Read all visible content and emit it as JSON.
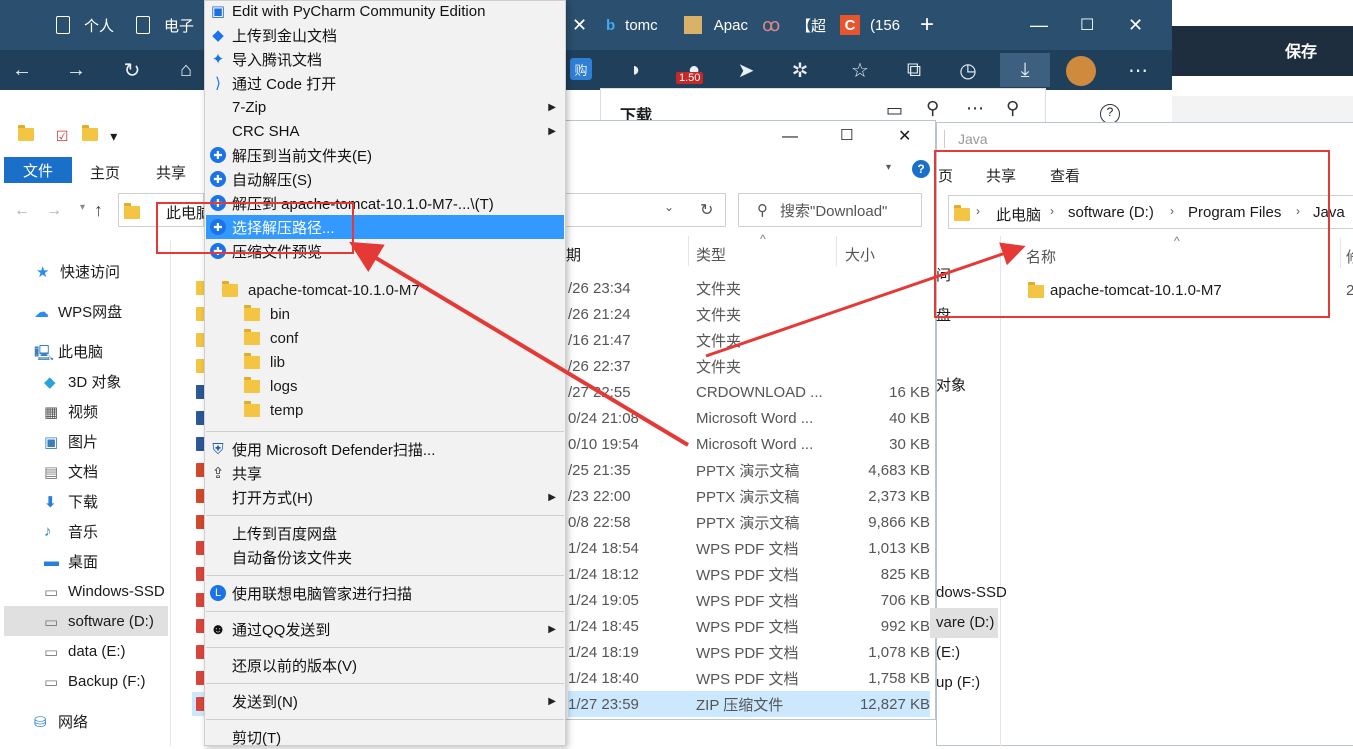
{
  "browser": {
    "tabs": [
      "个人",
      "电子",
      "tomc",
      "Apac",
      "【超",
      "(156"
    ],
    "tab_badge": "1.50",
    "save_label": "保存"
  },
  "downloads_panel": {
    "title": "下载"
  },
  "explorer_left": {
    "ribbon": [
      "文件",
      "主页",
      "共享"
    ],
    "breadcrumb": "此电脑",
    "search_placeholder": "搜索\"Download\"",
    "sidebar": [
      "快速访问",
      "WPS网盘",
      "此电脑",
      "3D 对象",
      "视频",
      "图片",
      "文档",
      "下载",
      "音乐",
      "桌面",
      "Windows-SSD",
      "software (D:)",
      "data (E:)",
      "Backup (F:)",
      "网络"
    ],
    "columns": {
      "date": "期",
      "type": "类型",
      "size": "大小"
    },
    "rows": [
      {
        "date": "/26 23:34",
        "type": "文件夹",
        "size": ""
      },
      {
        "date": "/26 21:24",
        "type": "文件夹",
        "size": ""
      },
      {
        "date": "/16 21:47",
        "type": "文件夹",
        "size": ""
      },
      {
        "date": "/26 22:37",
        "type": "文件夹",
        "size": ""
      },
      {
        "date": "/27 22:55",
        "type": "CRDOWNLOAD ...",
        "size": "16 KB"
      },
      {
        "date": "0/24 21:08",
        "type": "Microsoft Word ...",
        "size": "40 KB"
      },
      {
        "date": "0/10 19:54",
        "type": "Microsoft Word ...",
        "size": "30 KB"
      },
      {
        "date": "/25 21:35",
        "type": "PPTX 演示文稿",
        "size": "4,683 KB"
      },
      {
        "date": "/23 22:00",
        "type": "PPTX 演示文稿",
        "size": "2,373 KB"
      },
      {
        "date": "0/8 22:58",
        "type": "PPTX 演示文稿",
        "size": "9,866 KB"
      },
      {
        "date": "1/24 18:54",
        "type": "WPS PDF 文档",
        "size": "1,013 KB"
      },
      {
        "date": "1/24 18:12",
        "type": "WPS PDF 文档",
        "size": "825 KB"
      },
      {
        "date": "1/24 19:05",
        "type": "WPS PDF 文档",
        "size": "706 KB"
      },
      {
        "date": "1/24 18:45",
        "type": "WPS PDF 文档",
        "size": "992 KB"
      },
      {
        "date": "1/24 18:19",
        "type": "WPS PDF 文档",
        "size": "1,078 KB"
      },
      {
        "date": "1/24 18:40",
        "type": "WPS PDF 文档",
        "size": "1,758 KB"
      },
      {
        "date": "1/27 23:59",
        "type": "ZIP 压缩文件",
        "size": "12,827 KB"
      }
    ]
  },
  "explorer_right": {
    "title": "Java",
    "ribbon": [
      "页",
      "共享",
      "查看"
    ],
    "breadcrumb": [
      "此电脑",
      "software (D:)",
      "Program Files",
      "Java"
    ],
    "column_name": "名称",
    "item": "apache-tomcat-10.1.0-M7",
    "partial_side": [
      "问",
      "盘",
      "对象",
      "dows-SSD",
      "vare (D:)",
      "(E:)",
      "up (F:)"
    ],
    "partial_col": [
      "修",
      "2"
    ]
  },
  "context_menu": {
    "items": [
      {
        "label": "Edit with PyCharm Community Edition",
        "icon": "pycharm-icon"
      },
      {
        "label": "上传到金山文档",
        "icon": "kdocs-icon"
      },
      {
        "label": "导入腾讯文档",
        "icon": "tencent-docs-icon"
      },
      {
        "label": "通过 Code 打开",
        "icon": "vscode-icon"
      },
      {
        "label": "7-Zip",
        "icon": "",
        "submenu": true
      },
      {
        "label": "CRC SHA",
        "icon": "",
        "submenu": true
      },
      {
        "label": "解压到当前文件夹(E)",
        "icon": "extract-icon"
      },
      {
        "label": "自动解压(S)",
        "icon": "extract-icon"
      },
      {
        "label": "解压到 apache-tomcat-10.1.0-M7-...\\(T)",
        "icon": "extract-icon"
      },
      {
        "label": "选择解压路径...",
        "icon": "extract-icon",
        "highlight": true
      },
      {
        "label": "压缩文件预览",
        "icon": "extract-icon"
      }
    ],
    "preview_tree": [
      "apache-tomcat-10.1.0-M7",
      "bin",
      "conf",
      "lib",
      "logs",
      "temp"
    ],
    "items2": [
      {
        "label": "使用 Microsoft Defender扫描...",
        "icon": "defender-icon"
      },
      {
        "label": "共享",
        "icon": "share-icon"
      },
      {
        "label": "打开方式(H)",
        "icon": "",
        "submenu": true
      }
    ],
    "items3": [
      "上传到百度网盘",
      "自动备份该文件夹"
    ],
    "items4": [
      {
        "label": "使用联想电脑管家进行扫描",
        "icon": "lenovo-icon"
      },
      {
        "label": "通过QQ发送到",
        "icon": "qq-icon",
        "submenu": true
      },
      {
        "label": "还原以前的版本(V)",
        "icon": ""
      },
      {
        "label": "发送到(N)",
        "icon": "",
        "submenu": true
      },
      {
        "label": "剪切(T)",
        "icon": ""
      }
    ]
  },
  "colors": {
    "highlight": "#3399ff",
    "annotation": "#e53935",
    "browser_tab": "#2b4f6e"
  }
}
